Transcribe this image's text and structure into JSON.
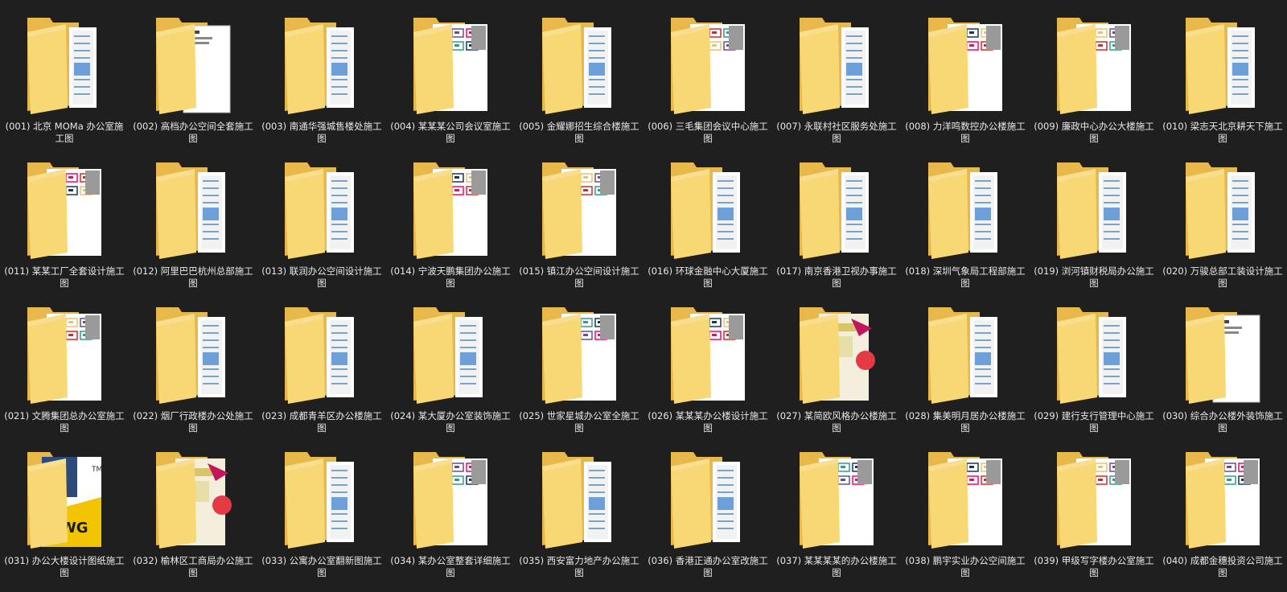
{
  "colors": {
    "background": "#1f1f1f",
    "folder_back": "#e8b84a",
    "folder_front": "#f8d775",
    "text": "#e8e8e8"
  },
  "items": [
    {
      "name": "(001) 北京 MOMa 办公室施工图",
      "icon": "folder-generic-icon"
    },
    {
      "name": "(002) 高档办公空间全套施工图",
      "icon": "folder-document-icon"
    },
    {
      "name": "(003) 南通华强城售楼处施工图",
      "icon": "folder-generic-icon"
    },
    {
      "name": "(004) 某某某公司会议室施工图",
      "icon": "folder-drawing-icon"
    },
    {
      "name": "(005) 金耀娜招生综合楼施工图",
      "icon": "folder-generic-icon"
    },
    {
      "name": "(006) 三毛集团会议中心施工图",
      "icon": "folder-drawing-icon"
    },
    {
      "name": "(007) 永联村社区服务处施工图",
      "icon": "folder-generic-icon"
    },
    {
      "name": "(008) 力洋鸣数控办公楼施工图",
      "icon": "folder-drawing-icon"
    },
    {
      "name": "(009) 廉政中心办公大楼施工图",
      "icon": "folder-drawing-icon"
    },
    {
      "name": "(010) 梁志天北京耕天下施工图",
      "icon": "folder-generic-icon"
    },
    {
      "name": "(011) 某某工厂全套设计施工图",
      "icon": "folder-drawing-icon"
    },
    {
      "name": "(012) 阿里巴巴杭州总部施工图",
      "icon": "folder-generic-icon"
    },
    {
      "name": "(013) 联润办公空间设计施工图",
      "icon": "folder-generic-icon"
    },
    {
      "name": "(014) 宁波天鹏集团办公施工图",
      "icon": "folder-drawing-icon"
    },
    {
      "name": "(015) 镇江办公空间设计施工图",
      "icon": "folder-drawing-icon"
    },
    {
      "name": "(016) 环球金融中心大厦施工图",
      "icon": "folder-generic-icon"
    },
    {
      "name": "(017) 南京香港卫视办事施工图",
      "icon": "folder-generic-icon"
    },
    {
      "name": "(018) 深圳气象局工程部施工图",
      "icon": "folder-generic-icon"
    },
    {
      "name": "(019) 浏河镇财税局办公施工图",
      "icon": "folder-generic-icon"
    },
    {
      "name": "(020) 万骏总部工装设计施工图",
      "icon": "folder-generic-icon"
    },
    {
      "name": "(021) 文腾集团总办公室施工图",
      "icon": "folder-drawing-icon"
    },
    {
      "name": "(022) 烟厂行政楼办公处施工图",
      "icon": "folder-generic-icon"
    },
    {
      "name": "(023) 成都青羊区办公楼施工图",
      "icon": "folder-generic-icon"
    },
    {
      "name": "(024) 某大厦办公室装饰施工图",
      "icon": "folder-generic-icon"
    },
    {
      "name": "(025) 世家星城办公室全施工图",
      "icon": "folder-drawing-icon"
    },
    {
      "name": "(026) 某某某办公楼设计施工图",
      "icon": "folder-drawing-icon"
    },
    {
      "name": "(027) 某简欧风格办公楼施工图",
      "icon": "folder-poster-icon"
    },
    {
      "name": "(028) 集美明月居办公楼施工图",
      "icon": "folder-generic-icon"
    },
    {
      "name": "(029) 建行支行管理中心施工图",
      "icon": "folder-generic-icon"
    },
    {
      "name": "(030) 综合办公楼外装饰施工图",
      "icon": "folder-document-icon"
    },
    {
      "name": "(031) 办公大楼设计图纸施工图",
      "icon": "folder-dwg-icon"
    },
    {
      "name": "(032) 榆林区工商局办公施工图",
      "icon": "folder-poster-icon"
    },
    {
      "name": "(033) 公寓办公室翻新图施工图",
      "icon": "folder-generic-icon"
    },
    {
      "name": "(034) 某办公室整套详细施工图",
      "icon": "folder-drawing-icon"
    },
    {
      "name": "(035) 西安富力地产办公施工图",
      "icon": "folder-generic-icon"
    },
    {
      "name": "(036) 香港正通办公室改施工图",
      "icon": "folder-generic-icon"
    },
    {
      "name": "(037) 某某某某的办公楼施工图",
      "icon": "folder-drawing-icon"
    },
    {
      "name": "(038) 鹏宇实业办公空间施工图",
      "icon": "folder-drawing-icon"
    },
    {
      "name": "(039) 甲级写字楼办公室施工图",
      "icon": "folder-drawing-icon"
    },
    {
      "name": "(040) 成都金穗投资公司施工图",
      "icon": "folder-drawing-icon"
    }
  ]
}
